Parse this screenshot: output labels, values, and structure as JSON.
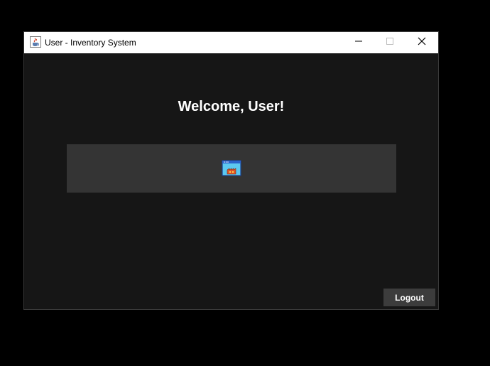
{
  "window": {
    "title": "User - Inventory System",
    "controls": {
      "minimize_icon": "minimize-icon",
      "maximize_icon": "maximize-icon",
      "close_icon": "close-icon"
    },
    "app_icon": "java-cup-icon"
  },
  "main": {
    "heading": "Welcome, User!",
    "panel_icon": "inventory-store-icon",
    "logout_label": "Logout"
  },
  "colors": {
    "background": "#161616",
    "panel": "#343434",
    "button": "#3c3c3c",
    "text": "#ffffff",
    "titlebar": "#ffffff"
  }
}
